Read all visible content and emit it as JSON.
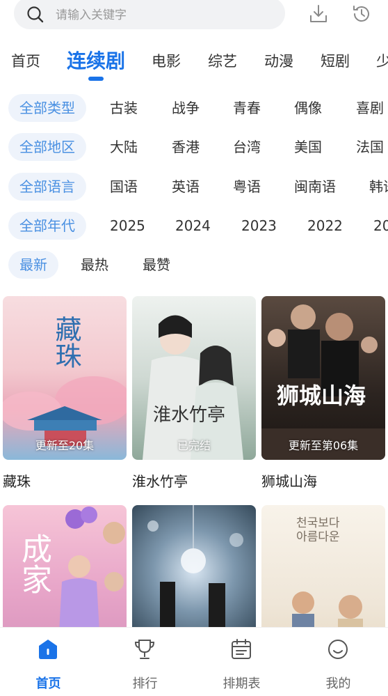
{
  "search": {
    "placeholder": "请输入关键字"
  },
  "top_icons": [
    "download-icon",
    "history-icon"
  ],
  "tabs": [
    {
      "label": "首页",
      "active": false
    },
    {
      "label": "连续剧",
      "active": true
    },
    {
      "label": "电影",
      "active": false
    },
    {
      "label": "综艺",
      "active": false
    },
    {
      "label": "动漫",
      "active": false
    },
    {
      "label": "短剧",
      "active": false
    },
    {
      "label": "少",
      "active": false
    }
  ],
  "filters": {
    "type": [
      "全部类型",
      "古装",
      "战争",
      "青春",
      "偶像",
      "喜剧"
    ],
    "region": [
      "全部地区",
      "大陆",
      "香港",
      "台湾",
      "美国",
      "法国"
    ],
    "language": [
      "全部语言",
      "国语",
      "英语",
      "粤语",
      "闽南语",
      "韩语"
    ],
    "year": [
      "全部年代",
      "2025",
      "2024",
      "2023",
      "2022",
      "20"
    ],
    "sort": [
      "最新",
      "最热",
      "最赞"
    ]
  },
  "cards": [
    {
      "title": "藏珠",
      "badge": "更新至20集",
      "poster_text": "藏珠"
    },
    {
      "title": "淮水竹亭",
      "badge": "已完结",
      "poster_text": "淮水竹亭"
    },
    {
      "title": "狮城山海",
      "badge": "更新至第06集",
      "poster_text": "狮城山海"
    },
    {
      "title": "",
      "badge": "",
      "poster_text": "成家"
    },
    {
      "title": "",
      "badge": "",
      "poster_text": ""
    },
    {
      "title": "",
      "badge": "",
      "poster_text": "천국보다 아름다운"
    }
  ],
  "bottom_nav": [
    {
      "label": "首页",
      "icon": "home-icon",
      "active": true
    },
    {
      "label": "排行",
      "icon": "trophy-icon",
      "active": false
    },
    {
      "label": "排期表",
      "icon": "calendar-icon",
      "active": false
    },
    {
      "label": "我的",
      "icon": "profile-icon",
      "active": false
    }
  ],
  "colors": {
    "accent": "#1a73e8",
    "chip_bg": "#eef3fb",
    "chip_text": "#4a90e2"
  }
}
